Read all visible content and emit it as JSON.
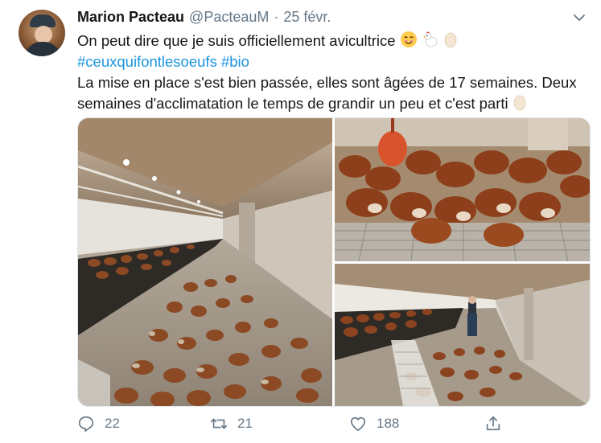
{
  "tweet": {
    "author_name": "Marion Pacteau",
    "author_handle": "@PacteauM",
    "separator": "·",
    "date": "25 févr.",
    "line1": "On peut dire que je suis officiellement avicultrice",
    "line1_emojis": [
      "smiling-face",
      "chicken",
      "egg"
    ],
    "hashtag1": "#ceuxquifontlesoeufs",
    "hashtag2": "#bio",
    "line3": "La mise en place s'est bien passée, elles sont âgées de 17 semaines. Deux semaines d'acclimatation le temps de grandir un peu et c'est parti",
    "line3_emoji": "egg"
  },
  "media": {
    "photo_count": 3
  },
  "actions": {
    "reply_count": "22",
    "retweet_count": "21",
    "like_count": "188"
  },
  "colors": {
    "text": "#14171a",
    "secondary": "#657786",
    "link": "#1b95e0",
    "border": "#e1e8ed"
  }
}
